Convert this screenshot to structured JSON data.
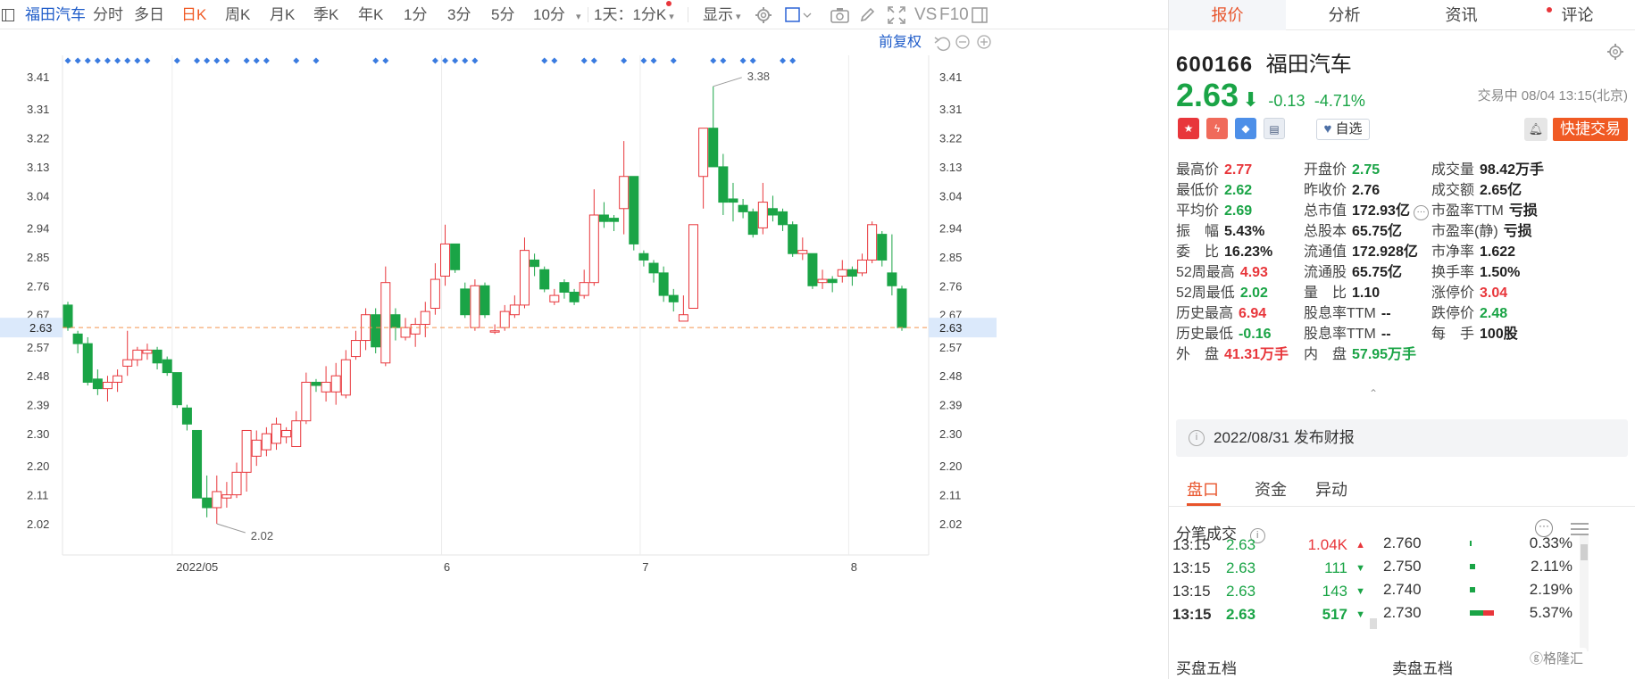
{
  "toolbar": {
    "stock_name": "福田汽车",
    "tabs": [
      "分时",
      "多日",
      "日K",
      "周K",
      "月K",
      "季K",
      "年K",
      "1分",
      "3分",
      "5分",
      "10分"
    ],
    "active_tab": "日K",
    "multi_period": "1天：1分K",
    "display": "显示",
    "vs": "VS",
    "f10": "F10",
    "fuquan": "前复权"
  },
  "chart_data": {
    "type": "candlestick",
    "y_ticks": [
      3.41,
      3.31,
      3.22,
      3.13,
      3.04,
      2.94,
      2.85,
      2.76,
      2.67,
      2.57,
      2.48,
      2.39,
      2.3,
      2.2,
      2.11,
      2.02
    ],
    "y_ticks_text": [
      "3.41",
      "3.31",
      "3.22",
      "3.13",
      "3.04",
      "2.94",
      "2.85",
      "2.76",
      "2.67",
      "2.57",
      "2.48",
      "2.39",
      "2.30",
      "2.20",
      "2.11",
      "2.02"
    ],
    "x_labels": [
      "2022/05",
      "6",
      "7",
      "8"
    ],
    "current_price": 2.63,
    "current_price_label": "2.63",
    "max_label": "3.38",
    "min_label": "2.02",
    "bull_color": "#e8363b",
    "bear_color": "#1aa446",
    "candles": [
      [
        2.7,
        2.63,
        2.71,
        2.62
      ],
      [
        2.61,
        2.58,
        2.62,
        2.55
      ],
      [
        2.58,
        2.46,
        2.6,
        2.45
      ],
      [
        2.47,
        2.44,
        2.5,
        2.42
      ],
      [
        2.44,
        2.46,
        2.48,
        2.4
      ],
      [
        2.46,
        2.48,
        2.5,
        2.43
      ],
      [
        2.51,
        2.53,
        2.62,
        2.48
      ],
      [
        2.53,
        2.56,
        2.57,
        2.51
      ],
      [
        2.55,
        2.56,
        2.58,
        2.53
      ],
      [
        2.56,
        2.52,
        2.57,
        2.5
      ],
      [
        2.53,
        2.49,
        2.54,
        2.48
      ],
      [
        2.49,
        2.39,
        2.49,
        2.38
      ],
      [
        2.38,
        2.33,
        2.39,
        2.31
      ],
      [
        2.31,
        2.1,
        2.31,
        2.1
      ],
      [
        2.1,
        2.07,
        2.17,
        2.04
      ],
      [
        2.07,
        2.12,
        2.17,
        2.02
      ],
      [
        2.1,
        2.11,
        2.15,
        2.07
      ],
      [
        2.11,
        2.18,
        2.21,
        2.1
      ],
      [
        2.18,
        2.31,
        2.31,
        2.12
      ],
      [
        2.23,
        2.28,
        2.31,
        2.2
      ],
      [
        2.25,
        2.3,
        2.32,
        2.23
      ],
      [
        2.27,
        2.33,
        2.35,
        2.25
      ],
      [
        2.29,
        2.31,
        2.32,
        2.27
      ],
      [
        2.26,
        2.34,
        2.37,
        2.26
      ],
      [
        2.34,
        2.46,
        2.49,
        2.33
      ],
      [
        2.46,
        2.45,
        2.47,
        2.43
      ],
      [
        2.43,
        2.46,
        2.51,
        2.4
      ],
      [
        2.43,
        2.48,
        2.52,
        2.39
      ],
      [
        2.42,
        2.53,
        2.56,
        2.41
      ],
      [
        2.54,
        2.59,
        2.62,
        2.53
      ],
      [
        2.59,
        2.67,
        2.69,
        2.56
      ],
      [
        2.67,
        2.57,
        2.69,
        2.55
      ],
      [
        2.52,
        2.77,
        2.82,
        2.51
      ],
      [
        2.67,
        2.63,
        2.69,
        2.59
      ],
      [
        2.6,
        2.63,
        2.66,
        2.59
      ],
      [
        2.61,
        2.64,
        2.66,
        2.57
      ],
      [
        2.64,
        2.68,
        2.71,
        2.6
      ],
      [
        2.69,
        2.78,
        2.83,
        2.67
      ],
      [
        2.79,
        2.89,
        2.95,
        2.76
      ],
      [
        2.89,
        2.81,
        2.89,
        2.8
      ],
      [
        2.75,
        2.67,
        2.77,
        2.66
      ],
      [
        2.63,
        2.76,
        2.78,
        2.62
      ],
      [
        2.76,
        2.67,
        2.77,
        2.66
      ],
      [
        2.62,
        2.62,
        2.64,
        2.61
      ],
      [
        2.63,
        2.68,
        2.7,
        2.62
      ],
      [
        2.67,
        2.7,
        2.73,
        2.66
      ],
      [
        2.7,
        2.87,
        2.91,
        2.69
      ],
      [
        2.84,
        2.82,
        2.86,
        2.79
      ],
      [
        2.81,
        2.75,
        2.82,
        2.74
      ],
      [
        2.71,
        2.73,
        2.75,
        2.7
      ],
      [
        2.77,
        2.74,
        2.78,
        2.72
      ],
      [
        2.74,
        2.71,
        2.75,
        2.7
      ],
      [
        2.73,
        2.77,
        2.81,
        2.72
      ],
      [
        2.77,
        2.98,
        3.06,
        2.76
      ],
      [
        2.98,
        2.96,
        3.02,
        2.94
      ],
      [
        2.97,
        2.96,
        2.98,
        2.93
      ],
      [
        3.0,
        3.1,
        3.21,
        2.92
      ],
      [
        3.1,
        2.89,
        3.1,
        2.87
      ],
      [
        2.86,
        2.84,
        2.87,
        2.82
      ],
      [
        2.83,
        2.8,
        2.84,
        2.77
      ],
      [
        2.8,
        2.73,
        2.82,
        2.71
      ],
      [
        2.73,
        2.71,
        2.75,
        2.68
      ],
      [
        2.65,
        2.67,
        2.73,
        2.65
      ],
      [
        2.69,
        2.95,
        2.95,
        2.69
      ],
      [
        3.1,
        3.25,
        3.25,
        3.0
      ],
      [
        3.25,
        3.13,
        3.38,
        3.13
      ],
      [
        3.13,
        3.02,
        3.17,
        2.98
      ],
      [
        3.03,
        3.02,
        3.08,
        2.96
      ],
      [
        3.01,
        2.99,
        3.03,
        2.97
      ],
      [
        2.99,
        2.92,
        3.0,
        2.91
      ],
      [
        2.94,
        3.02,
        3.08,
        2.92
      ],
      [
        3.0,
        2.98,
        3.04,
        2.96
      ],
      [
        2.99,
        2.95,
        3.0,
        2.93
      ],
      [
        2.95,
        2.86,
        2.96,
        2.85
      ],
      [
        2.86,
        2.87,
        2.91,
        2.84
      ],
      [
        2.86,
        2.76,
        2.86,
        2.75
      ],
      [
        2.77,
        2.78,
        2.81,
        2.75
      ],
      [
        2.78,
        2.77,
        2.79,
        2.74
      ],
      [
        2.79,
        2.81,
        2.84,
        2.77
      ],
      [
        2.81,
        2.79,
        2.82,
        2.76
      ],
      [
        2.8,
        2.84,
        2.86,
        2.79
      ],
      [
        2.84,
        2.95,
        2.96,
        2.83
      ],
      [
        2.92,
        2.84,
        2.93,
        2.82
      ],
      [
        2.8,
        2.76,
        2.92,
        2.73
      ],
      [
        2.75,
        2.63,
        2.76,
        2.62
      ]
    ],
    "x_label_index": [
      15,
      38,
      58,
      79
    ],
    "event_markers": [
      0,
      1,
      2,
      3,
      4,
      5,
      6,
      7,
      8,
      11,
      13,
      14,
      15,
      16,
      18,
      19,
      20,
      23,
      25,
      31,
      32,
      37,
      38,
      39,
      40,
      41,
      48,
      49,
      52,
      53,
      56,
      58,
      59,
      61,
      65,
      66,
      68,
      69,
      72,
      73
    ]
  },
  "quote": {
    "code": "600166",
    "name": "福田汽车",
    "price": "2.63",
    "arrow": "⬇",
    "change": "-0.13",
    "change_pct": "-4.71%",
    "trade_time": "交易中 08/04 13:15(北京)",
    "watch_label": "自选",
    "fast_trade": "快捷交易",
    "stats": [
      {
        "k": "最高价",
        "v": "2.77",
        "c": "up"
      },
      {
        "k": "开盘价",
        "v": "2.75",
        "c": "down"
      },
      {
        "k": "成交量",
        "v": "98.42万手",
        "c": "flat"
      },
      {
        "k": "最低价",
        "v": "2.62",
        "c": "down"
      },
      {
        "k": "昨收价",
        "v": "2.76",
        "c": "flat"
      },
      {
        "k": "成交额",
        "v": "2.65亿",
        "c": "flat"
      },
      {
        "k": "平均价",
        "v": "2.69",
        "c": "down"
      },
      {
        "k": "总市值",
        "v": "172.93亿",
        "c": "flat"
      },
      {
        "k": "市盈率TTM",
        "v": "亏损",
        "c": "flat"
      },
      {
        "k": "振　幅",
        "v": "5.43%",
        "c": "flat"
      },
      {
        "k": "总股本",
        "v": "65.75亿",
        "c": "flat"
      },
      {
        "k": "市盈率(静)",
        "v": "亏损",
        "c": "flat"
      },
      {
        "k": "委　比",
        "v": "16.23%",
        "c": "flat"
      },
      {
        "k": "流通值",
        "v": "172.928亿",
        "c": "flat"
      },
      {
        "k": "市净率",
        "v": "1.622",
        "c": "flat"
      },
      {
        "k": "52周最高",
        "v": "4.93",
        "c": "up"
      },
      {
        "k": "流通股",
        "v": "65.75亿",
        "c": "flat"
      },
      {
        "k": "换手率",
        "v": "1.50%",
        "c": "flat"
      },
      {
        "k": "52周最低",
        "v": "2.02",
        "c": "down"
      },
      {
        "k": "量　比",
        "v": "1.10",
        "c": "flat"
      },
      {
        "k": "涨停价",
        "v": "3.04",
        "c": "up"
      },
      {
        "k": "历史最高",
        "v": "6.94",
        "c": "up"
      },
      {
        "k": "股息率TTM",
        "v": "--",
        "c": "flat"
      },
      {
        "k": "跌停价",
        "v": "2.48",
        "c": "down"
      },
      {
        "k": "历史最低",
        "v": "-0.16",
        "c": "down"
      },
      {
        "k": "股息率TTM",
        "v": "--",
        "c": "flat"
      },
      {
        "k": "每　手",
        "v": "100股",
        "c": "flat"
      },
      {
        "k": "外　盘",
        "v": "41.31万手",
        "c": "up"
      },
      {
        "k": "内　盘",
        "v": "57.95万手",
        "c": "down"
      },
      {
        "k": "",
        "v": "",
        "c": "flat"
      }
    ]
  },
  "right_tabs": [
    "报价",
    "分析",
    "资讯",
    "评论"
  ],
  "notice": "2022/08/31  发布财报",
  "bottom_tabs": [
    "盘口",
    "资金",
    "异动"
  ],
  "tick_title": "分笔成交",
  "ticks": [
    {
      "time": "13:15",
      "price": "2.63",
      "vol": "1.04K",
      "dir": "up"
    },
    {
      "time": "13:15",
      "price": "2.63",
      "vol": "111",
      "dir": "down"
    },
    {
      "time": "13:15",
      "price": "2.63",
      "vol": "143",
      "dir": "down"
    },
    {
      "time": "13:15",
      "price": "2.63",
      "vol": "517",
      "dir": "down"
    }
  ],
  "dist": [
    {
      "price": "2.760",
      "pct": "0.33%",
      "fill": 0.03
    },
    {
      "price": "2.750",
      "pct": "2.11%",
      "fill": 0.15
    },
    {
      "price": "2.740",
      "pct": "2.19%",
      "fill": 0.15
    },
    {
      "price": "2.730",
      "pct": "5.37%",
      "fill": 0.37
    }
  ],
  "buy_book": "买盘五档",
  "sell_book": "卖盘五档",
  "watermark": "格隆汇"
}
